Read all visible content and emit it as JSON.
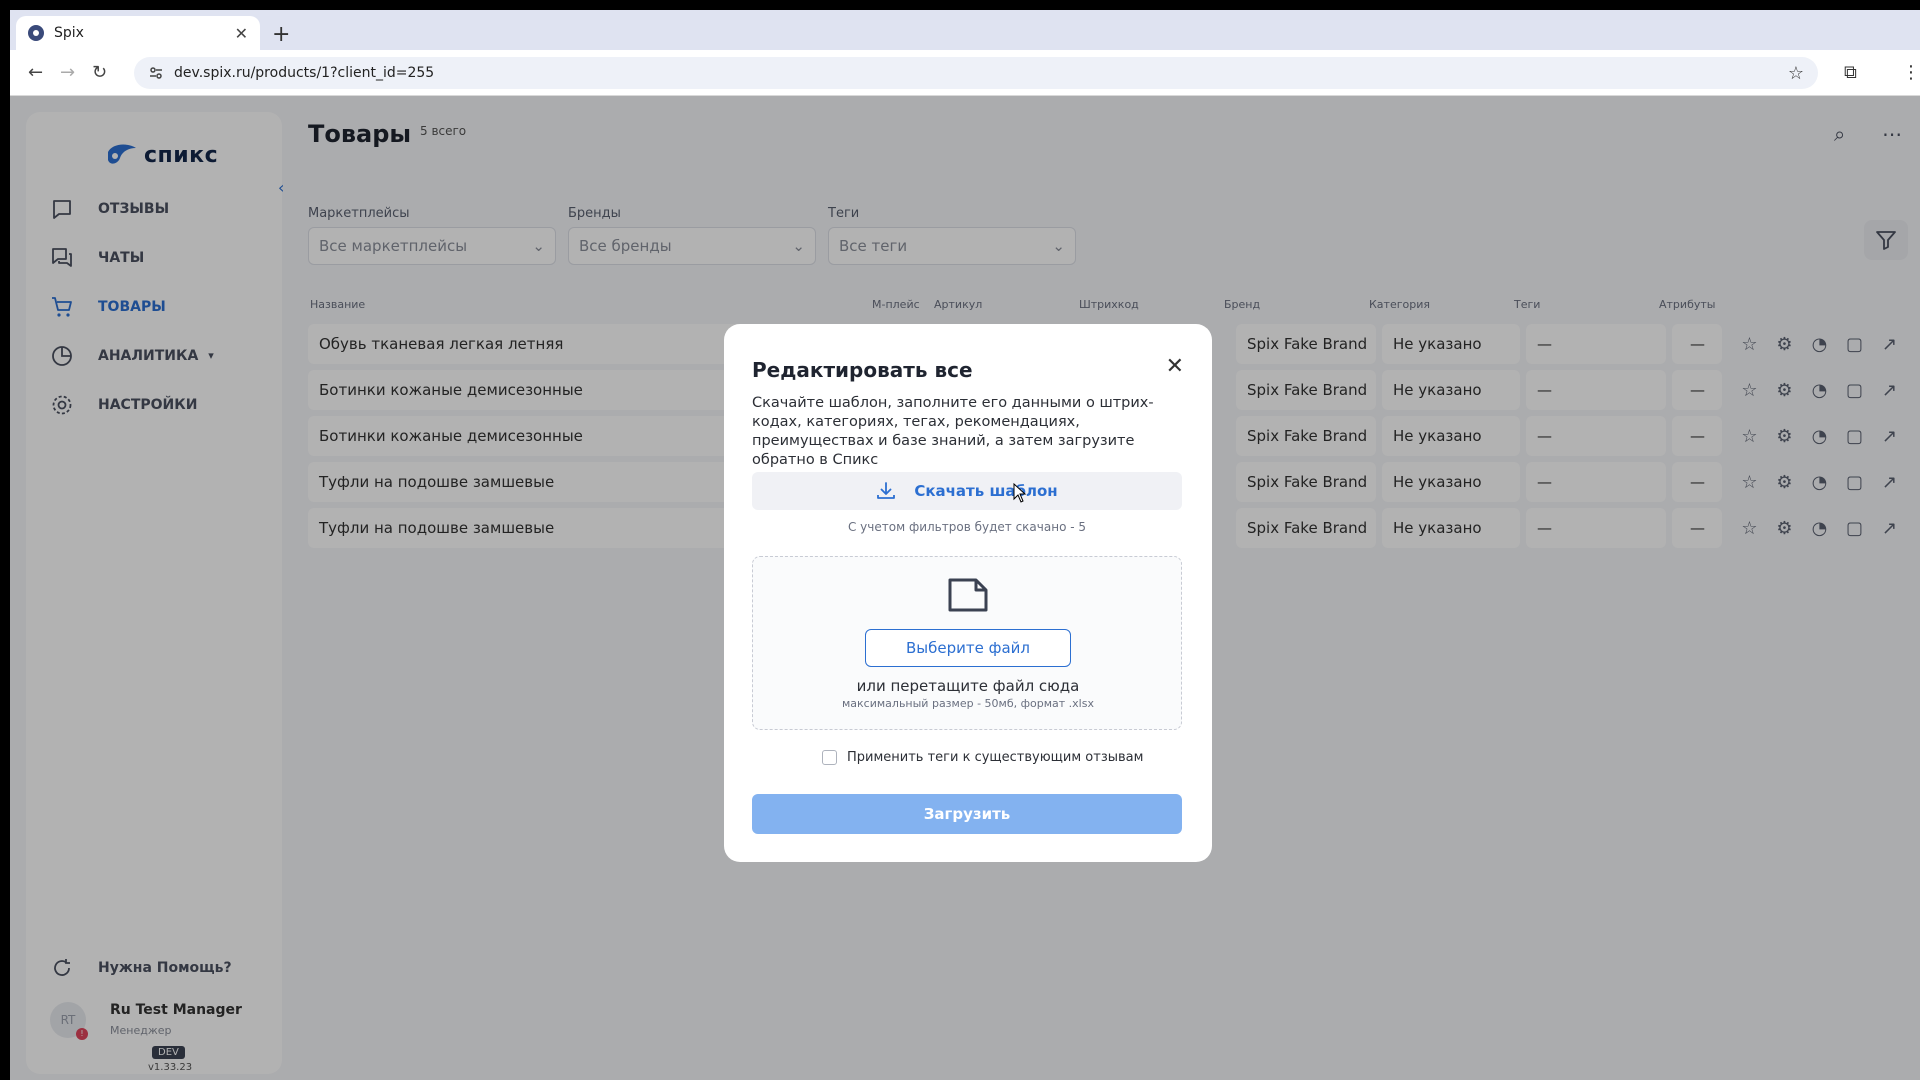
{
  "browser": {
    "tab_title": "Spix",
    "tab_close": "✕",
    "new_tab": "+",
    "url": "dev.spix.ru/products/1?client_id=255"
  },
  "sidebar": {
    "logo_text": "спикс",
    "items": [
      {
        "label": "Отзывы",
        "icon": "message-square-icon"
      },
      {
        "label": "Чаты",
        "icon": "chats-icon"
      },
      {
        "label": "Товары",
        "icon": "cart-icon",
        "active": true
      },
      {
        "label": "Аналитика",
        "icon": "pie-chart-icon",
        "has_submenu": true
      },
      {
        "label": "Настройки",
        "icon": "gear-icon"
      }
    ],
    "help": "Нужна Помощь?",
    "user": {
      "initials": "RT",
      "name": "Ru Test Manager",
      "role": "Менеджер",
      "badge": "!"
    },
    "env_badge": "DEV",
    "version": "v1.33.23"
  },
  "page": {
    "title": "Товары",
    "count": "5 всего",
    "filters": [
      {
        "label": "Маркетплейсы",
        "value": "Все маркетплейсы"
      },
      {
        "label": "Бренды",
        "value": "Все бренды"
      },
      {
        "label": "Теги",
        "value": "Все теги"
      }
    ],
    "columns": [
      "Название",
      "М-плейс",
      "Артикул",
      "Штрихкод",
      "Бренд",
      "Категория",
      "Теги",
      "Атрибуты"
    ],
    "rows": [
      {
        "name": "Обувь тканевая легкая летняя",
        "brand": "Spix Fake Brand",
        "category": "Не указано",
        "tags": "—",
        "attrs": "—"
      },
      {
        "name": "Ботинки кожаные демисезонные",
        "brand": "Spix Fake Brand",
        "category": "Не указано",
        "tags": "—",
        "attrs": "—"
      },
      {
        "name": "Ботинки кожаные демисезонные",
        "brand": "Spix Fake Brand",
        "category": "Не указано",
        "tags": "—",
        "attrs": "—"
      },
      {
        "name": "Туфли на подошве замшевые",
        "brand": "Spix Fake Brand",
        "category": "Не указано",
        "tags": "—",
        "attrs": "—"
      },
      {
        "name": "Туфли на подошве замшевые",
        "brand": "Spix Fake Brand",
        "category": "Не указано",
        "tags": "—",
        "attrs": "—"
      }
    ]
  },
  "modal": {
    "title": "Редактировать все",
    "description": "Скачайте шаблон, заполните его данными о штрих-кодах, категориях, тегах, рекомендациях, преимуществах и базе знаний, а затем загрузите обратно в Спикс",
    "download_label": "Скачать шаблон",
    "download_note": "С учетом фильтров будет скачано - 5",
    "choose_file": "Выберите файл",
    "drop_text": "или перетащите файл сюда",
    "drop_hint": "максимальный размер - 50мб, формат .xlsx",
    "checkbox_label": "Применить теги к существующим отзывам",
    "checkbox_checked": false,
    "upload_label": "Загрузить"
  },
  "colors": {
    "accent": "#2c6fd1",
    "upload_disabled": "#83b2f0"
  }
}
